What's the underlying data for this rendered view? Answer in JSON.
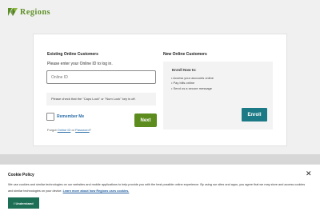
{
  "brand": {
    "name": "Regions",
    "color": "#5b8f22"
  },
  "existing": {
    "heading": "Existing Online Customers",
    "prompt": "Please enter your Online ID to log in.",
    "online_id_placeholder": "Online ID",
    "online_id_value": "",
    "caps_note": "Please check that the \"Caps Lock\" or \"Num Lock\" key is off.",
    "remember_label": "Remember Me",
    "remember_checked": false,
    "forgot_prefix": "Forgot ",
    "forgot_online_id": "Online ID",
    "forgot_or": " or ",
    "forgot_password": "Password",
    "forgot_suffix": "?",
    "next_label": "Next"
  },
  "new_customers": {
    "heading": "New Online Customers",
    "enroll_title": "Enroll Now to:",
    "items": [
      "Access your accounts online",
      "Pay bills online",
      "Send us a secure message"
    ],
    "enroll_label": "Enroll"
  },
  "cookie": {
    "title": "Cookie Policy",
    "close_symbol": "✕",
    "text": "We use cookies and similar technologies on our websites and mobile applications to help provide you with the best possible online experience. By using our sites and apps, you agree that we may store and access cookies and similar technologies on your device. ",
    "link": "Learn more about how Regions uses cookies.",
    "button_label": "I Understand"
  },
  "colors": {
    "next": "#5c8b1e",
    "enroll": "#1c7a86",
    "understand": "#1c6e55",
    "link": "#2b6ea8"
  }
}
